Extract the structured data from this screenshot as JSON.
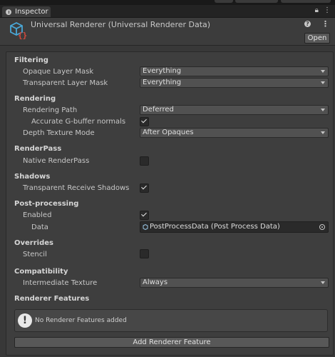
{
  "window": {
    "tab_label": "Inspector",
    "tab_icons": [
      "lock-icon",
      "more-icon"
    ]
  },
  "header": {
    "title": "Universal Renderer (Universal Renderer Data)",
    "open_label": "Open",
    "icons": [
      "asset-icon",
      "help-icon",
      "more-icon"
    ]
  },
  "sections": {
    "filtering": {
      "title": "Filtering",
      "opaque_layer_mask": {
        "label": "Opaque Layer Mask",
        "value": "Everything"
      },
      "transparent_layer_mask": {
        "label": "Transparent Layer Mask",
        "value": "Everything"
      }
    },
    "rendering": {
      "title": "Rendering",
      "rendering_path": {
        "label": "Rendering Path",
        "value": "Deferred"
      },
      "accurate_gbuffer_normals": {
        "label": "Accurate G-buffer normals",
        "checked": true
      },
      "depth_texture_mode": {
        "label": "Depth Texture Mode",
        "value": "After Opaques"
      }
    },
    "renderpass": {
      "title": "RenderPass",
      "native_renderpass": {
        "label": "Native RenderPass",
        "checked": false
      }
    },
    "shadows": {
      "title": "Shadows",
      "transparent_receive_shadows": {
        "label": "Transparent Receive Shadows",
        "checked": true
      }
    },
    "post_processing": {
      "title": "Post-processing",
      "enabled": {
        "label": "Enabled",
        "checked": true
      },
      "data": {
        "label": "Data",
        "value": "PostProcessData (Post Process Data)"
      }
    },
    "overrides": {
      "title": "Overrides",
      "stencil": {
        "label": "Stencil",
        "checked": false
      }
    },
    "compatibility": {
      "title": "Compatibility",
      "intermediate_texture": {
        "label": "Intermediate Texture",
        "value": "Always"
      }
    },
    "renderer_features": {
      "title": "Renderer Features",
      "empty_message": "No Renderer Features added",
      "add_button_label": "Add Renderer Feature"
    }
  },
  "colors": {
    "background": "#383838",
    "panel": "#3e3e3e",
    "field": "#515151",
    "asset_icon_blue": "#4aa8d8",
    "asset_icon_red": "#d84a3c"
  }
}
